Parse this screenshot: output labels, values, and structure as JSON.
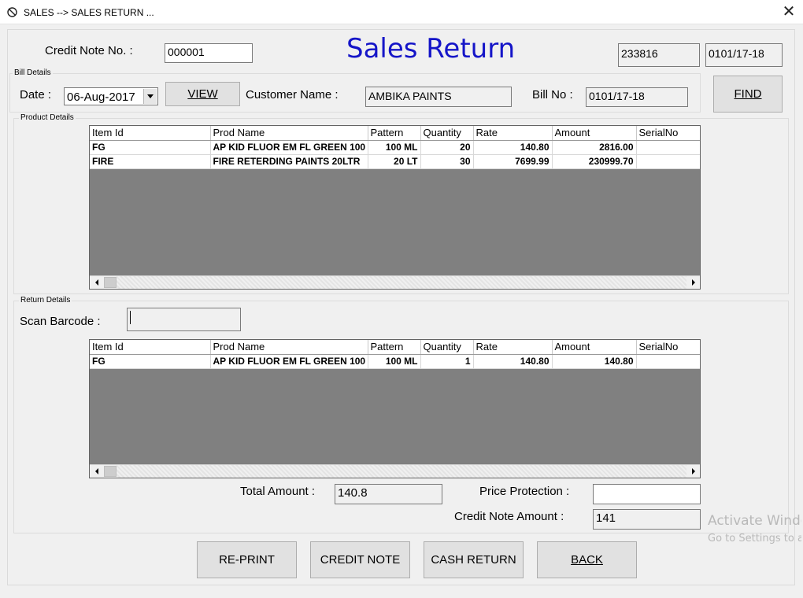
{
  "window": {
    "title": "SALES --> SALES RETURN ...",
    "icon": "no-entry-icon",
    "close_glyph": "✕"
  },
  "header": {
    "credit_note_label": "Credit Note No. :",
    "credit_note_value": "000001",
    "heading": "Sales Return",
    "box1_value": "233816",
    "box2_value": "0101/17-18"
  },
  "bill_details": {
    "legend": "Bill Details",
    "date_label": "Date :",
    "date_value": "06-Aug-2017",
    "view_button": "VIEW",
    "customer_label": "Customer Name :",
    "customer_value": "AMBIKA PAINTS",
    "bill_no_label": "Bill No :",
    "bill_no_value": "0101/17-18",
    "find_button": "FIND"
  },
  "product_details": {
    "legend": "Product Details",
    "columns": [
      "Item Id",
      "Prod Name",
      "Pattern",
      "Quantity",
      "Rate",
      "Amount",
      "SerialNo"
    ],
    "rows": [
      [
        "FG",
        "AP KID FLUOR EM FL GREEN 100",
        "100 ML",
        "20",
        "140.80",
        "2816.00",
        ""
      ],
      [
        "FIRE",
        "FIRE RETERDING PAINTS 20LTR",
        "20 LT",
        "30",
        "7699.99",
        "230999.70",
        ""
      ]
    ]
  },
  "return_details": {
    "legend": "Return Details",
    "scan_label": "Scan Barcode :",
    "scan_value": "",
    "columns": [
      "Item Id",
      "Prod Name",
      "Pattern",
      "Quantity",
      "Rate",
      "Amount",
      "SerialNo"
    ],
    "rows": [
      [
        "FG",
        "AP KID FLUOR EM FL GREEN 100",
        "100 ML",
        "1",
        "140.80",
        "140.80",
        ""
      ]
    ],
    "total_amount_label": "Total Amount :",
    "total_amount_value": "140.8",
    "price_protection_label": "Price Protection :",
    "price_protection_value": "",
    "credit_note_amount_label": "Credit Note Amount :",
    "credit_note_amount_value": "141"
  },
  "buttons": {
    "reprint": "RE-PRINT",
    "credit_note": "CREDIT NOTE",
    "cash_return": "CASH RETURN",
    "back": "BACK"
  },
  "watermark": {
    "line1": "Activate Windows",
    "line2": "Go to Settings to activate Windows."
  }
}
